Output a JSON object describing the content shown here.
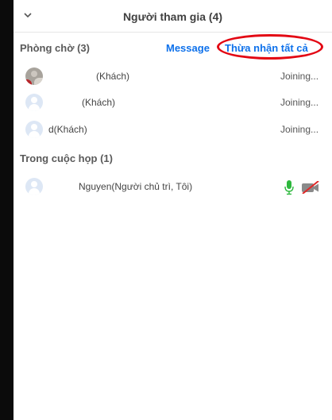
{
  "panel": {
    "title": "Người tham gia (4)"
  },
  "waiting_room": {
    "title": "Phòng chờ (3)",
    "message_label": "Message",
    "admit_all_label": "Thừa nhận tất cả",
    "participants": [
      {
        "name": "(Khách)",
        "status": "Joining..."
      },
      {
        "name": "(Khách)",
        "status": "Joining..."
      },
      {
        "name": "d(Khách)",
        "status": "Joining..."
      }
    ]
  },
  "in_meeting": {
    "title": "Trong cuộc họp (1)",
    "participants": [
      {
        "name": "Nguyen(Người chủ trì, Tôi)",
        "mic": "mic-on-icon",
        "video": "video-off-icon"
      }
    ]
  },
  "colors": {
    "link": "#0e71eb",
    "highlight": "#e30613",
    "mic": "#2db83d",
    "video_off": "#e02828"
  }
}
